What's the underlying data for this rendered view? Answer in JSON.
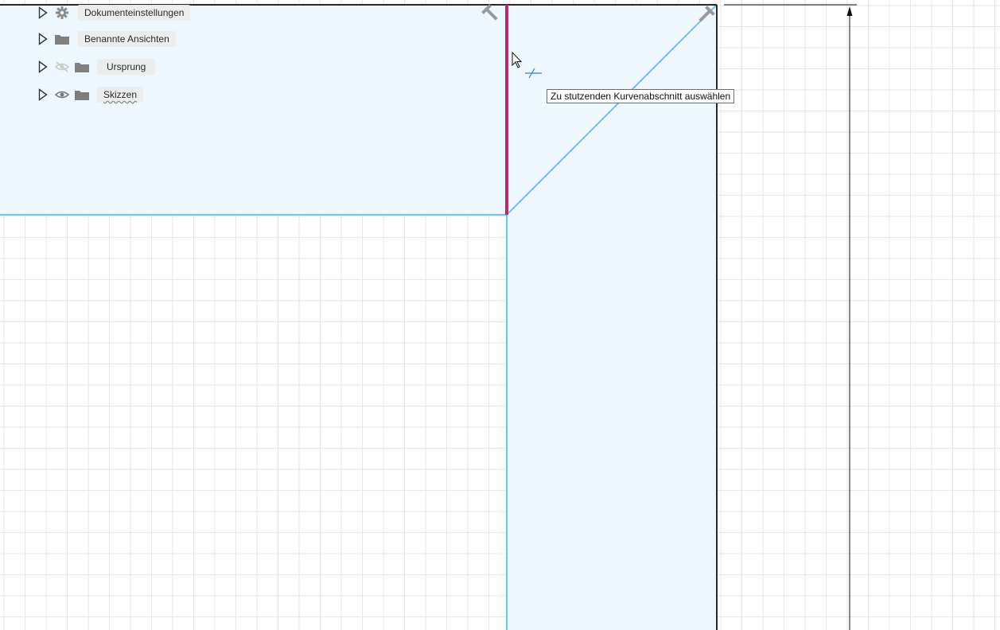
{
  "browser": {
    "items": [
      {
        "label": "Dokumenteinstellungen",
        "icon": "gear-icon",
        "visibility": "none"
      },
      {
        "label": "Benannte Ansichten",
        "icon": "folder-icon",
        "visibility": "none"
      },
      {
        "label": "Ursprung",
        "icon": "folder-icon",
        "visibility": "eye-hidden-icon"
      },
      {
        "label": "Skizzen",
        "icon": "folder-icon",
        "visibility": "eye-icon"
      }
    ]
  },
  "tooltip": {
    "text": "Zu stutzenden Kurvenabschnitt auswählen"
  },
  "colors": {
    "sketch_line": "#6ec3ea",
    "profile_fill": "#eef7fd",
    "highlight": "#b0306f",
    "grid_minor": "#e6e6e6",
    "dimension": "#111111"
  }
}
